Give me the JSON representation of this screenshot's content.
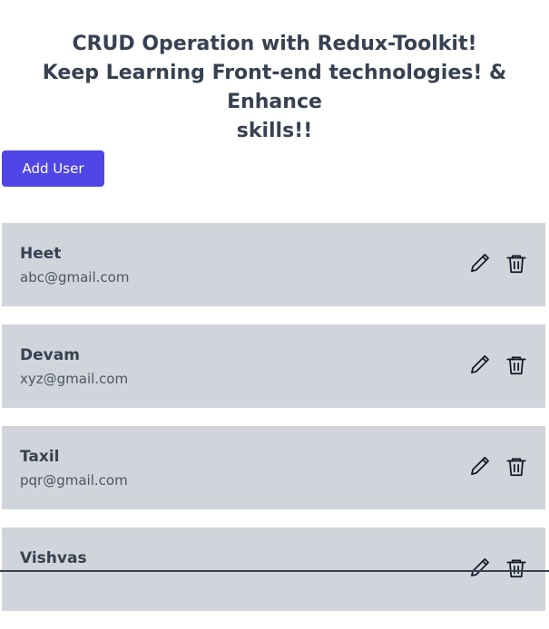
{
  "header": {
    "line1": "CRUD Operation with Redux-Toolkit!",
    "line2": "Keep Learning Front-end technologies! & Enhance",
    "line3": "skills!!"
  },
  "toolbar": {
    "add_label": "Add User"
  },
  "users": [
    {
      "name": "Heet",
      "email": "abc@gmail.com"
    },
    {
      "name": "Devam",
      "email": "xyz@gmail.com"
    },
    {
      "name": "Taxil",
      "email": "pqr@gmail.com"
    },
    {
      "name": "Vishvas",
      "email": ""
    }
  ],
  "icons": {
    "edit": "pencil-icon",
    "delete": "trash-icon"
  },
  "colors": {
    "accent": "#4f46e5",
    "card_bg": "#d1d5db",
    "text": "#374151"
  }
}
